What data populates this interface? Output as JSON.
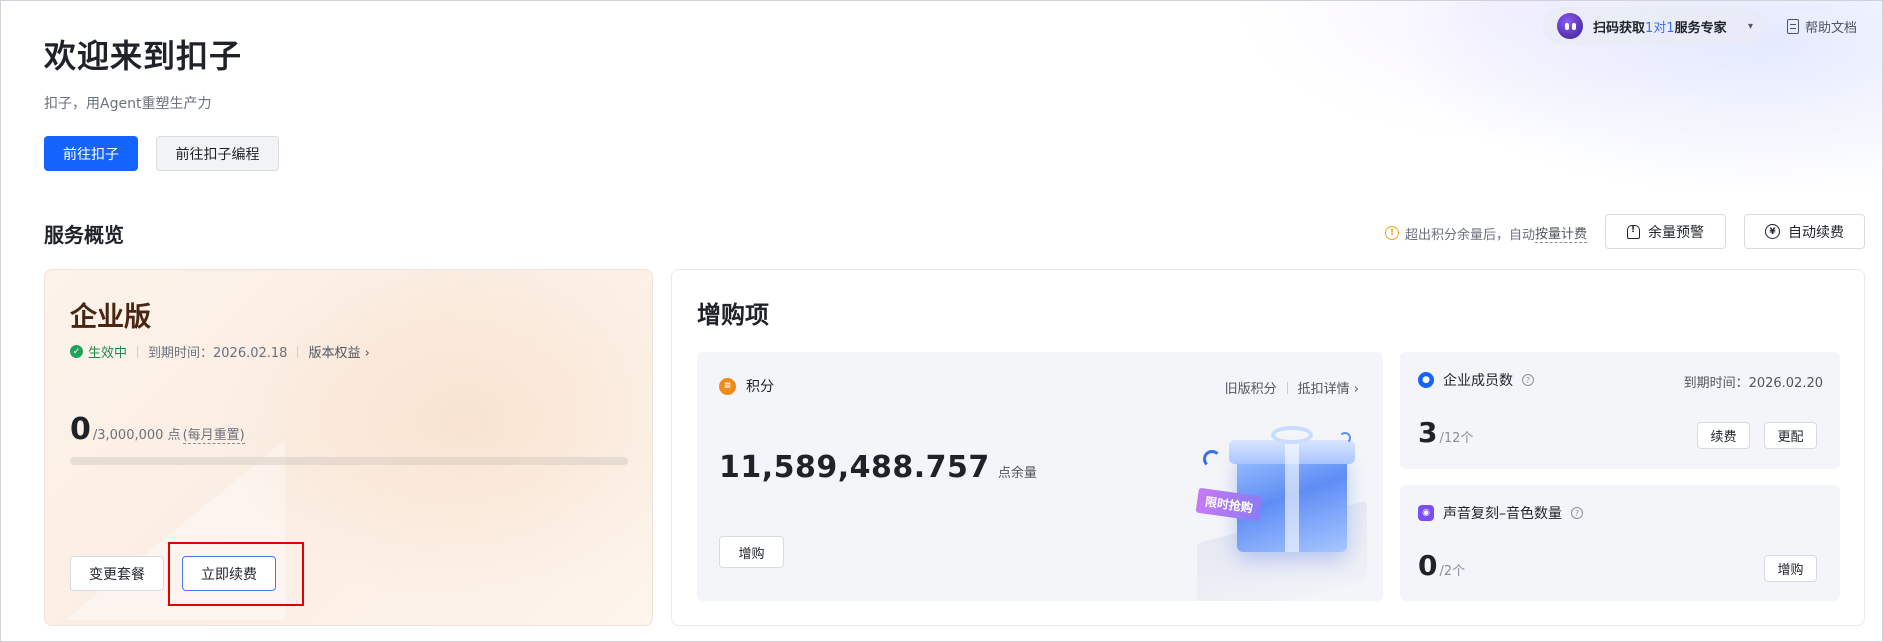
{
  "top": {
    "service": {
      "prefix": "扫码获取",
      "highlight": "1对1",
      "suffix": "服务专家"
    },
    "help_doc": "帮助文档"
  },
  "header": {
    "title": "欢迎来到扣子",
    "subtitle": "扣子，用Agent重塑生产力",
    "primary_button": "前往扣子",
    "secondary_button": "前往扣子编程"
  },
  "overview": {
    "title": "服务概览",
    "overage_note_prefix": "超出积分余量后，自动",
    "overage_note_link": "按量计费",
    "balance_alert_button": "余量预警",
    "auto_renew_button": "自动续费"
  },
  "plan": {
    "name": "企业版",
    "status": "生效中",
    "expiry": "到期时间：2026.02.18",
    "rights_link": "版本权益",
    "rights_chevron": "›",
    "usage_value": "0",
    "usage_total": "/3,000,000 点",
    "usage_note": "(每月重置)",
    "usage_fraction": 0,
    "change_button": "变更套餐",
    "renew_button": "立即续费"
  },
  "addons": {
    "title": "增购项",
    "credits": {
      "label": "积分",
      "old_credits_link": "旧版积分",
      "deduction_link": "抵扣详情",
      "chevron": "›",
      "value": "11,589,488.757",
      "unit": "点余量",
      "buy_button": "增购",
      "promo_tag": "限时抢购"
    },
    "members": {
      "label": "企业成员数",
      "expiry": "到期时间：2026.02.20",
      "count": "3",
      "total": "/12个",
      "renew_button": "续费",
      "upgrade_button": "更配"
    },
    "voice": {
      "label": "声音复刻–音色数量",
      "count": "0",
      "total": "/2个",
      "buy_button": "增购"
    }
  },
  "colors": {
    "primary": "#1664ff",
    "status_ok": "#1fa35b",
    "warning": "#f2a31b",
    "highlight_box": "#e60000"
  },
  "icons": {
    "service_avatar": "bot-avatar-icon",
    "help": "document-icon",
    "warning": "warning-circle-icon",
    "alert": "bell-alert-icon",
    "auto_renew": "yen-circle-icon",
    "status": "check-circle-icon",
    "credits": "coin-icon",
    "members": "user-icon",
    "voice": "voice-clone-icon",
    "help_hint": "question-circle-icon"
  }
}
